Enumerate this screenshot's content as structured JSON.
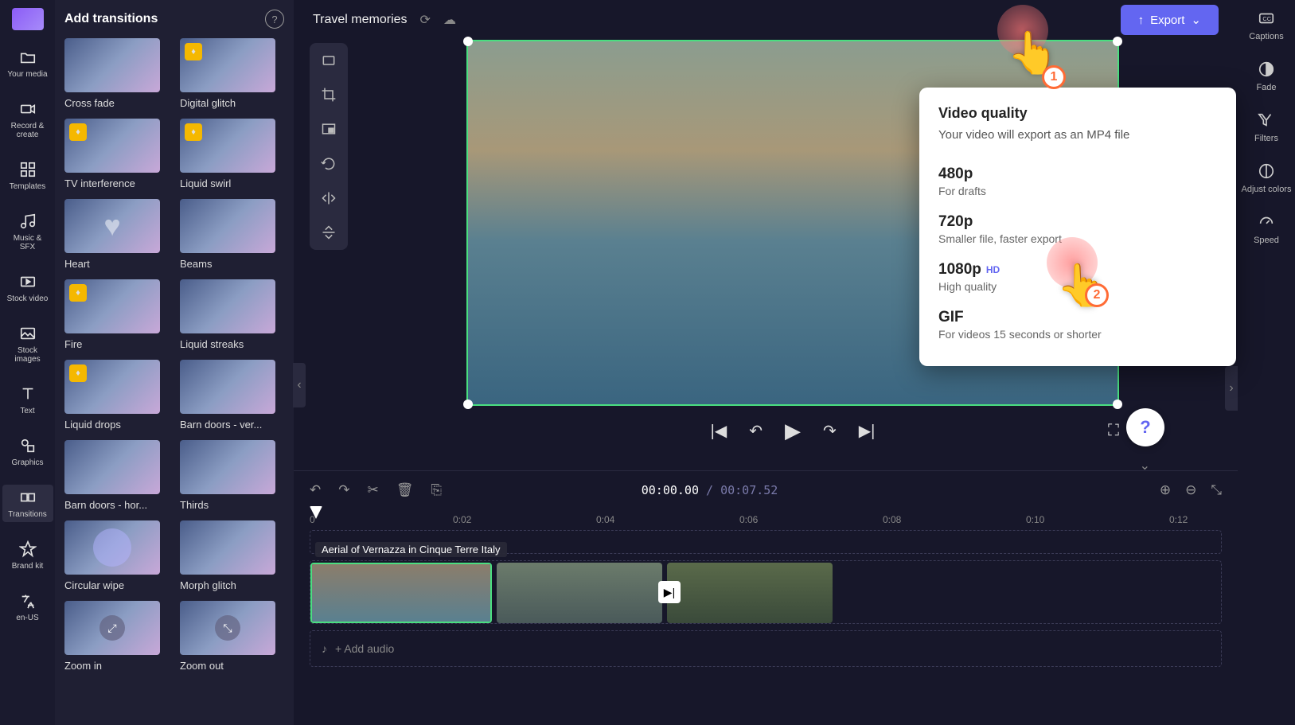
{
  "project": {
    "title": "Travel memories"
  },
  "export": {
    "button_label": "Export"
  },
  "left_nav": {
    "items": [
      {
        "label": "Your media"
      },
      {
        "label": "Record & create"
      },
      {
        "label": "Templates"
      },
      {
        "label": "Music & SFX"
      },
      {
        "label": "Stock video"
      },
      {
        "label": "Stock images"
      },
      {
        "label": "Text"
      },
      {
        "label": "Graphics"
      },
      {
        "label": "Transitions"
      },
      {
        "label": "Brand kit"
      },
      {
        "label": "en-US"
      }
    ]
  },
  "transitions_panel": {
    "title": "Add transitions",
    "items": [
      {
        "label": "Cross fade",
        "premium": false
      },
      {
        "label": "Digital glitch",
        "premium": true
      },
      {
        "label": "TV interference",
        "premium": true
      },
      {
        "label": "Liquid swirl",
        "premium": true
      },
      {
        "label": "Heart",
        "premium": false
      },
      {
        "label": "Beams",
        "premium": false
      },
      {
        "label": "Fire",
        "premium": true
      },
      {
        "label": "Liquid streaks",
        "premium": false
      },
      {
        "label": "Liquid drops",
        "premium": true
      },
      {
        "label": "Barn doors - ver...",
        "premium": false
      },
      {
        "label": "Barn doors - hor...",
        "premium": false
      },
      {
        "label": "Thirds",
        "premium": false
      },
      {
        "label": "Circular wipe",
        "premium": false
      },
      {
        "label": "Morph glitch",
        "premium": false
      },
      {
        "label": "Zoom in",
        "premium": false
      },
      {
        "label": "Zoom out",
        "premium": false
      }
    ]
  },
  "export_popup": {
    "title": "Video quality",
    "subtitle": "Your video will export as an MP4 file",
    "options": [
      {
        "name": "480p",
        "desc": "For drafts",
        "hd": false
      },
      {
        "name": "720p",
        "desc": "Smaller file, faster export",
        "hd": false
      },
      {
        "name": "1080p",
        "desc": "High quality",
        "hd": true
      },
      {
        "name": "GIF",
        "desc": "For videos 15 seconds or shorter",
        "hd": false
      }
    ],
    "hd_label": "HD"
  },
  "right_tools": {
    "items": [
      {
        "label": "Captions"
      },
      {
        "label": "Fade"
      },
      {
        "label": "Filters"
      },
      {
        "label": "Adjust colors"
      },
      {
        "label": "Speed"
      }
    ]
  },
  "timeline": {
    "current": "00:00.00",
    "separator": " / ",
    "total": "00:07.52",
    "ruler": [
      "0",
      "0:02",
      "0:04",
      "0:06",
      "0:08",
      "0:10",
      "0:12"
    ],
    "clip_title": "Aerial of Vernazza in Cinque Terre Italy",
    "add_audio": "+ Add audio"
  },
  "hints": {
    "one": "1",
    "two": "2"
  },
  "colors": {
    "accent": "#6366f1",
    "selected": "#4ade80",
    "hint": "#ff6b35"
  }
}
